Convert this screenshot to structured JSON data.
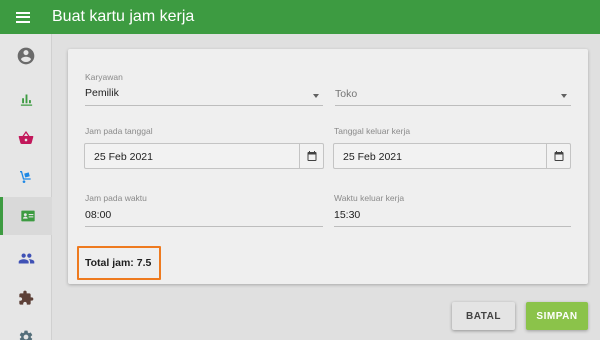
{
  "appbar": {
    "title": "Buat kartu jam kerja"
  },
  "sidebar": {
    "items": [
      {
        "name": "account",
        "icon": "account-circle-icon",
        "color": "#6b6b6b"
      },
      {
        "name": "reports",
        "icon": "bar-chart-icon",
        "color": "#3d9b41"
      },
      {
        "name": "sales",
        "icon": "basket-icon",
        "color": "#c2185b"
      },
      {
        "name": "inventory",
        "icon": "dolly-icon",
        "color": "#1e88e5"
      },
      {
        "name": "timecards",
        "icon": "badge-icon",
        "color": "#3d9b41",
        "active": true
      },
      {
        "name": "customers",
        "icon": "people-icon",
        "color": "#3f51b5"
      },
      {
        "name": "integrations",
        "icon": "puzzle-icon",
        "color": "#5d4037"
      },
      {
        "name": "settings",
        "icon": "gear-icon",
        "color": "#546e7a"
      }
    ]
  },
  "form": {
    "employee": {
      "label": "Karyawan",
      "value": "Pemilik"
    },
    "store": {
      "placeholder": "Toko"
    },
    "clock_in_date": {
      "label": "Jam pada tanggal",
      "value": "25 Feb 2021"
    },
    "clock_out_date": {
      "label": "Tanggal keluar kerja",
      "value": "25 Feb 2021"
    },
    "clock_in_time": {
      "label": "Jam pada waktu",
      "value": "08:00"
    },
    "clock_out_time": {
      "label": "Waktu keluar kerja",
      "value": "15:30"
    },
    "total": "Total jam: 7.5"
  },
  "actions": {
    "cancel": "BATAL",
    "save": "SIMPAN"
  },
  "colors": {
    "primary": "#3d9b41",
    "save": "#8bc34a",
    "highlight": "#ee7a1f"
  }
}
